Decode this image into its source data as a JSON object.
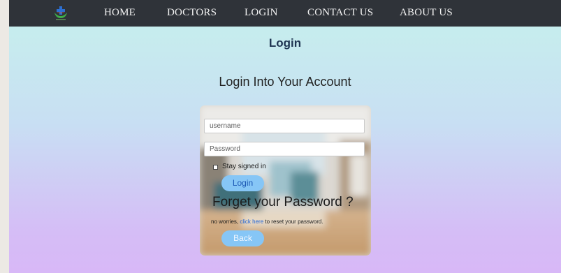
{
  "nav": {
    "items": [
      "HOME",
      "DOCTORS",
      "LOGIN",
      "CONTACT US",
      "ABOUT US"
    ]
  },
  "page": {
    "title": "Login",
    "subtitle": "Login Into Your Account"
  },
  "form": {
    "username_placeholder": "username",
    "password_placeholder": "Password",
    "stay_signed_in_label": "Stay signed in",
    "login_label": "Login",
    "forget_heading": "Forget your Password ?",
    "reset_prefix": "no worries, ",
    "reset_link": "click here",
    "reset_suffix": " to reset your password.",
    "back_label": "Back"
  },
  "colors": {
    "navbar": "#2f3339",
    "button": "#86c6f6",
    "link": "#1f63d6"
  },
  "icons": {
    "logo": "medical-cross-logo-icon"
  }
}
